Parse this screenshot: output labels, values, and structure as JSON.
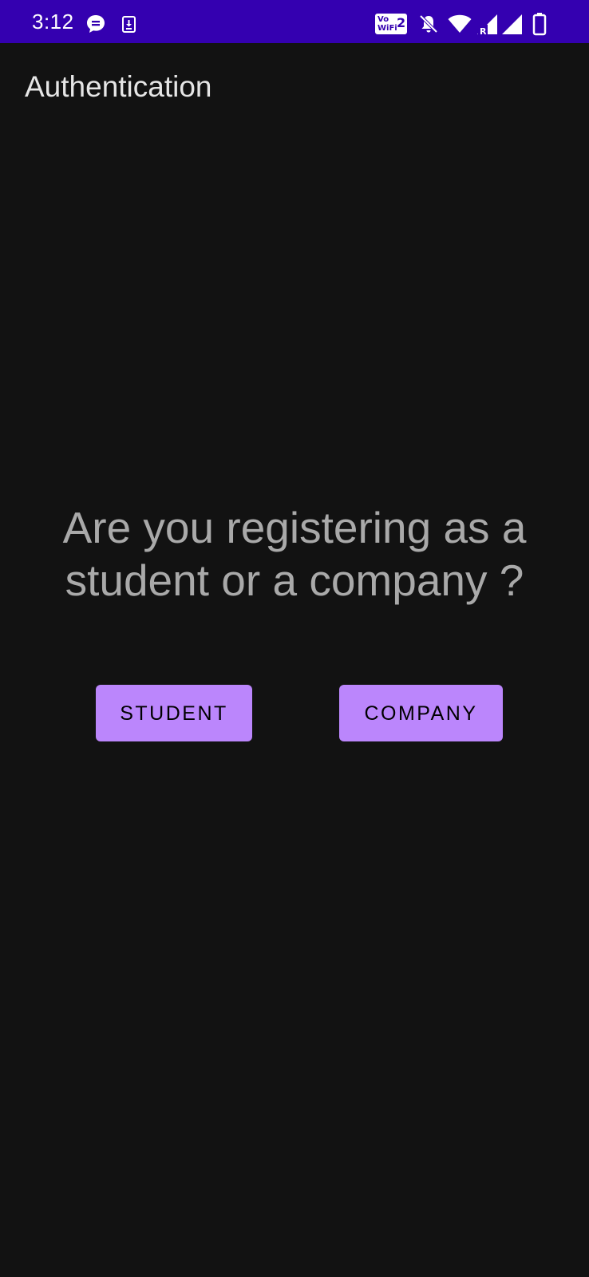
{
  "status_bar": {
    "time": "3:12",
    "background_color": "#3400b0",
    "left_icons": [
      "message-icon",
      "download-icon"
    ],
    "vowifi": {
      "line1": "Vo",
      "line2": "WiFi",
      "sim": "2"
    },
    "right_icons": [
      "notifications-off-icon",
      "wifi-icon",
      "signal-roaming-icon",
      "signal-icon",
      "battery-icon"
    ],
    "roaming_label": "R"
  },
  "app_bar": {
    "title": "Authentication"
  },
  "main": {
    "question": "Are you registering as a student or a company ?",
    "student_button_label": "STUDENT",
    "company_button_label": "COMPANY",
    "accent_color": "#bb86fc",
    "background_color": "#121212"
  }
}
